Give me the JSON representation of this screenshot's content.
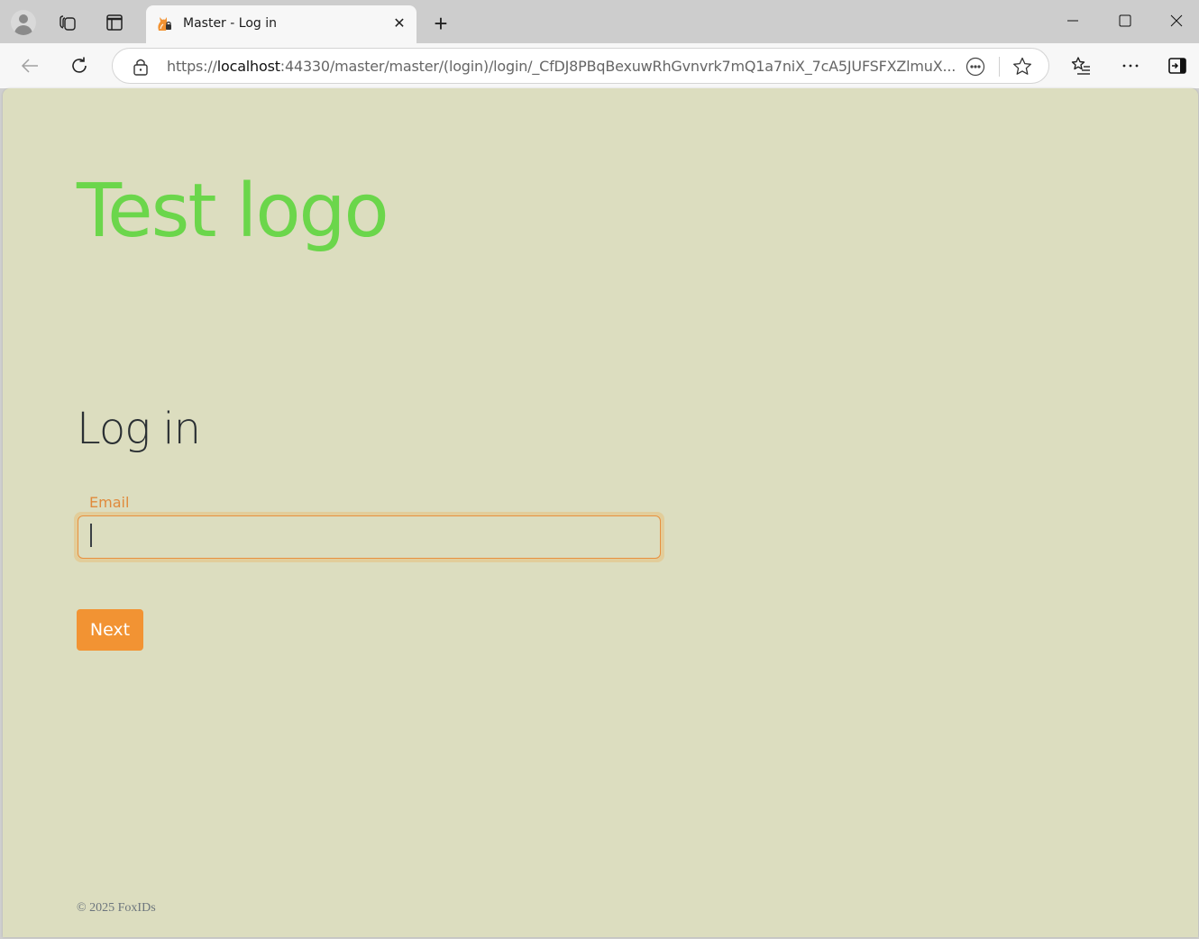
{
  "browser": {
    "tab": {
      "title": "Master - Log in",
      "favicon": "foxids-fox-lock-icon"
    },
    "address_bar": {
      "scheme": "https://",
      "host": "localhost",
      "rest": ":44330/master/master/(login)/login/_CfDJ8PBqBexuwRhGvnvrk7mQ1a7niX_7cA5JUFSFXZlmuX..."
    },
    "icons": {
      "new_tab": "+",
      "tab_close": "✕"
    }
  },
  "page": {
    "logo_text": "Test logo",
    "heading": "Log in",
    "email": {
      "label": "Email",
      "value": "",
      "placeholder": ""
    },
    "next_label": "Next",
    "footer": "© 2025 FoxIDs",
    "colors": {
      "logo": "#6bd64b",
      "background": "#dcddbf",
      "accent": "#f29333",
      "label": "#e08a3c"
    }
  }
}
